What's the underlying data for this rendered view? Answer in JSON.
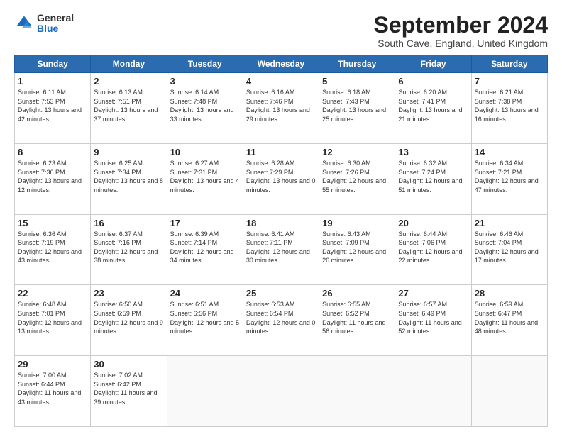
{
  "logo": {
    "general": "General",
    "blue": "Blue"
  },
  "header": {
    "month": "September 2024",
    "location": "South Cave, England, United Kingdom"
  },
  "weekdays": [
    "Sunday",
    "Monday",
    "Tuesday",
    "Wednesday",
    "Thursday",
    "Friday",
    "Saturday"
  ],
  "weeks": [
    [
      {
        "day": "1",
        "info": "Sunrise: 6:11 AM\nSunset: 7:53 PM\nDaylight: 13 hours\nand 42 minutes."
      },
      {
        "day": "2",
        "info": "Sunrise: 6:13 AM\nSunset: 7:51 PM\nDaylight: 13 hours\nand 37 minutes."
      },
      {
        "day": "3",
        "info": "Sunrise: 6:14 AM\nSunset: 7:48 PM\nDaylight: 13 hours\nand 33 minutes."
      },
      {
        "day": "4",
        "info": "Sunrise: 6:16 AM\nSunset: 7:46 PM\nDaylight: 13 hours\nand 29 minutes."
      },
      {
        "day": "5",
        "info": "Sunrise: 6:18 AM\nSunset: 7:43 PM\nDaylight: 13 hours\nand 25 minutes."
      },
      {
        "day": "6",
        "info": "Sunrise: 6:20 AM\nSunset: 7:41 PM\nDaylight: 13 hours\nand 21 minutes."
      },
      {
        "day": "7",
        "info": "Sunrise: 6:21 AM\nSunset: 7:38 PM\nDaylight: 13 hours\nand 16 minutes."
      }
    ],
    [
      {
        "day": "8",
        "info": "Sunrise: 6:23 AM\nSunset: 7:36 PM\nDaylight: 13 hours\nand 12 minutes."
      },
      {
        "day": "9",
        "info": "Sunrise: 6:25 AM\nSunset: 7:34 PM\nDaylight: 13 hours\nand 8 minutes."
      },
      {
        "day": "10",
        "info": "Sunrise: 6:27 AM\nSunset: 7:31 PM\nDaylight: 13 hours\nand 4 minutes."
      },
      {
        "day": "11",
        "info": "Sunrise: 6:28 AM\nSunset: 7:29 PM\nDaylight: 13 hours\nand 0 minutes."
      },
      {
        "day": "12",
        "info": "Sunrise: 6:30 AM\nSunset: 7:26 PM\nDaylight: 12 hours\nand 55 minutes."
      },
      {
        "day": "13",
        "info": "Sunrise: 6:32 AM\nSunset: 7:24 PM\nDaylight: 12 hours\nand 51 minutes."
      },
      {
        "day": "14",
        "info": "Sunrise: 6:34 AM\nSunset: 7:21 PM\nDaylight: 12 hours\nand 47 minutes."
      }
    ],
    [
      {
        "day": "15",
        "info": "Sunrise: 6:36 AM\nSunset: 7:19 PM\nDaylight: 12 hours\nand 43 minutes."
      },
      {
        "day": "16",
        "info": "Sunrise: 6:37 AM\nSunset: 7:16 PM\nDaylight: 12 hours\nand 38 minutes."
      },
      {
        "day": "17",
        "info": "Sunrise: 6:39 AM\nSunset: 7:14 PM\nDaylight: 12 hours\nand 34 minutes."
      },
      {
        "day": "18",
        "info": "Sunrise: 6:41 AM\nSunset: 7:11 PM\nDaylight: 12 hours\nand 30 minutes."
      },
      {
        "day": "19",
        "info": "Sunrise: 6:43 AM\nSunset: 7:09 PM\nDaylight: 12 hours\nand 26 minutes."
      },
      {
        "day": "20",
        "info": "Sunrise: 6:44 AM\nSunset: 7:06 PM\nDaylight: 12 hours\nand 22 minutes."
      },
      {
        "day": "21",
        "info": "Sunrise: 6:46 AM\nSunset: 7:04 PM\nDaylight: 12 hours\nand 17 minutes."
      }
    ],
    [
      {
        "day": "22",
        "info": "Sunrise: 6:48 AM\nSunset: 7:01 PM\nDaylight: 12 hours\nand 13 minutes."
      },
      {
        "day": "23",
        "info": "Sunrise: 6:50 AM\nSunset: 6:59 PM\nDaylight: 12 hours\nand 9 minutes."
      },
      {
        "day": "24",
        "info": "Sunrise: 6:51 AM\nSunset: 6:56 PM\nDaylight: 12 hours\nand 5 minutes."
      },
      {
        "day": "25",
        "info": "Sunrise: 6:53 AM\nSunset: 6:54 PM\nDaylight: 12 hours\nand 0 minutes."
      },
      {
        "day": "26",
        "info": "Sunrise: 6:55 AM\nSunset: 6:52 PM\nDaylight: 11 hours\nand 56 minutes."
      },
      {
        "day": "27",
        "info": "Sunrise: 6:57 AM\nSunset: 6:49 PM\nDaylight: 11 hours\nand 52 minutes."
      },
      {
        "day": "28",
        "info": "Sunrise: 6:59 AM\nSunset: 6:47 PM\nDaylight: 11 hours\nand 48 minutes."
      }
    ],
    [
      {
        "day": "29",
        "info": "Sunrise: 7:00 AM\nSunset: 6:44 PM\nDaylight: 11 hours\nand 43 minutes."
      },
      {
        "day": "30",
        "info": "Sunrise: 7:02 AM\nSunset: 6:42 PM\nDaylight: 11 hours\nand 39 minutes."
      },
      {
        "day": "",
        "info": ""
      },
      {
        "day": "",
        "info": ""
      },
      {
        "day": "",
        "info": ""
      },
      {
        "day": "",
        "info": ""
      },
      {
        "day": "",
        "info": ""
      }
    ]
  ]
}
